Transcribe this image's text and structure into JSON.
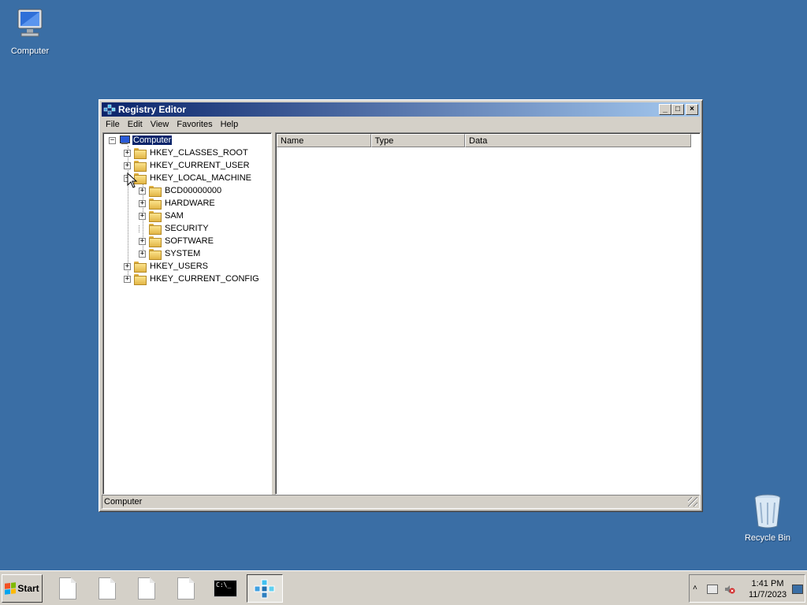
{
  "desktop": {
    "icons": [
      {
        "label": "Computer"
      },
      {
        "label": "Recycle Bin"
      }
    ]
  },
  "window": {
    "title": "Registry Editor",
    "buttons": {
      "minimize": "_",
      "maximize": "□",
      "close": "×"
    },
    "menu": [
      "File",
      "Edit",
      "View",
      "Favorites",
      "Help"
    ],
    "tree": {
      "root": "Computer",
      "hives": [
        "HKEY_CLASSES_ROOT",
        "HKEY_CURRENT_USER",
        "HKEY_LOCAL_MACHINE",
        "HKEY_USERS",
        "HKEY_CURRENT_CONFIG"
      ],
      "hklm_children": [
        "BCD00000000",
        "HARDWARE",
        "SAM",
        "SECURITY",
        "SOFTWARE",
        "SYSTEM"
      ]
    },
    "list_columns": [
      "Name",
      "Type",
      "Data"
    ],
    "status": "Computer"
  },
  "taskbar": {
    "start_label": "Start",
    "cmd_text": "C:\\_",
    "tray": {
      "arrow": "˄",
      "time": "1:41 PM",
      "date": "11/7/2023"
    }
  }
}
